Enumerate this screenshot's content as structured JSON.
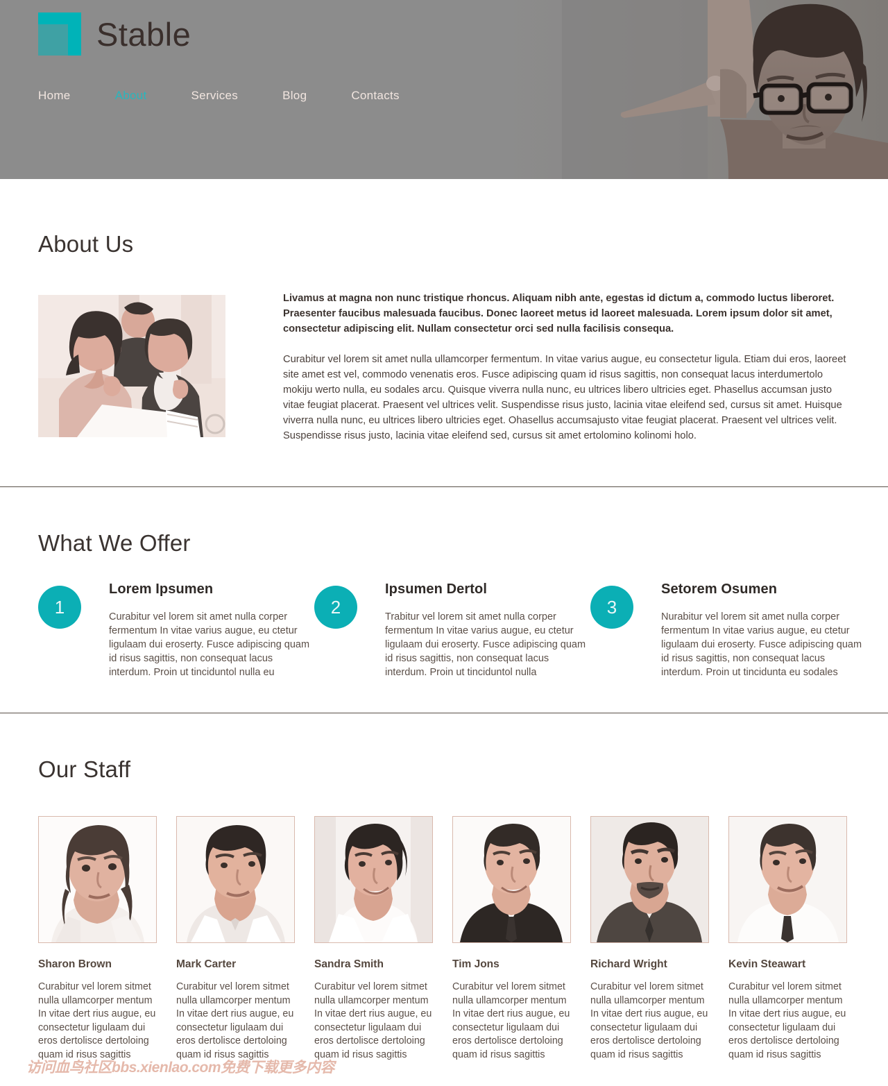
{
  "header": {
    "brand": "Stable",
    "logo_color": "#00b3b8",
    "nav": [
      {
        "label": "Home",
        "active": false
      },
      {
        "label": "About",
        "active": true
      },
      {
        "label": "Services",
        "active": false
      },
      {
        "label": "Blog",
        "active": false
      },
      {
        "label": "Contacts",
        "active": false
      }
    ],
    "hero_image_alt": "man-with-glasses-photo"
  },
  "about": {
    "title": "About Us",
    "image_alt": "two-women-reviewing-documents-photo",
    "paragraph_lead": "Livamus at magna non nunc tristique rhoncus. Aliquam nibh ante, egestas id dictum a, commodo luctus liberoret. Praesenter faucibus malesuada faucibus. Donec laoreet metus id laoreet malesuada. Lorem ipsum dolor sit amet, consectetur adipiscing elit. Nullam consectetur orci sed nulla facilisis consequa.",
    "paragraph_body": "Curabitur vel lorem sit amet nulla ullamcorper fermentum. In vitae varius augue, eu consectetur ligula. Etiam dui eros, laoreet site amet est vel, commodo venenatis eros. Fusce adipiscing quam id risus sagittis, non consequat lacus interdumertolo mokiju werto nulla, eu sodales arcu. Quisque viverra nulla nunc, eu ultrices libero ultricies eget. Phasellus accumsan justo vitae feugiat placerat. Praesent vel ultrices velit. Suspendisse risus justo, lacinia vitae eleifend sed, cursus sit amet. Huisque viverra nulla nunc, eu ultrices libero ultricies eget. Ohasellus accumsajusto vitae feugiat placerat. Praesent vel ultrices velit. Suspendisse risus justo, lacinia vitae eleifend sed, cursus sit amet ertolomino kolinomi holo."
  },
  "offer": {
    "title": "What We Offer",
    "accent_color": "#0bafb5",
    "items": [
      {
        "number": "1",
        "heading": "Lorem Ipsumen",
        "text": "Curabitur vel lorem sit amet nulla corper fermentum In vitae varius augue, eu ctetur ligulaam dui eroserty. Fusce adipiscing quam id risus sagittis, non consequat lacus interdum. Proin ut tinciduntol nulla eu"
      },
      {
        "number": "2",
        "heading": "Ipsumen Dertol",
        "text": "Trabitur vel lorem sit amet nulla corper fermentum In vitae varius augue, eu ctetur ligulaam dui eroserty. Fusce adipiscing quam id risus sagittis, non consequat lacus interdum. Proin ut tinciduntol nulla"
      },
      {
        "number": "3",
        "heading": "Setorem Osumen",
        "text": "Nurabitur vel lorem sit amet nulla corper fermentum In vitae varius augue, eu ctetur ligulaam dui eroserty. Fusce adipiscing quam id risus sagittis, non consequat lacus interdum. Proin ut tincidunta eu sodales"
      }
    ]
  },
  "staff": {
    "title": "Our Staff",
    "members": [
      {
        "name": "Sharon Brown",
        "bio": "Curabitur vel lorem sitmet nulla ullamcorper mentum In vitae dert rius augue, eu consectetur ligulaam dui eros dertolisce dertoloing quam id risus sagittis",
        "photo_alt": "portrait-sharon-brown"
      },
      {
        "name": "Mark Carter",
        "bio": "Curabitur vel lorem sitmet nulla ullamcorper mentum In vitae dert rius augue, eu consectetur ligulaam dui eros dertolisce dertoloing quam id risus sagittis",
        "photo_alt": "portrait-mark-carter"
      },
      {
        "name": "Sandra Smith",
        "bio": "Curabitur vel lorem sitmet nulla ullamcorper mentum In vitae dert rius augue, eu consectetur ligulaam dui eros dertolisce dertoloing quam id risus sagittis",
        "photo_alt": "portrait-sandra-smith"
      },
      {
        "name": "Tim Jons",
        "bio": "Curabitur vel lorem sitmet nulla ullamcorper mentum In vitae dert rius augue, eu consectetur ligulaam dui eros dertolisce dertoloing quam id risus sagittis",
        "photo_alt": "portrait-tim-jons"
      },
      {
        "name": "Richard Wright",
        "bio": "Curabitur vel lorem sitmet nulla ullamcorper mentum In vitae dert rius augue, eu consectetur ligulaam dui eros dertolisce dertoloing quam id risus sagittis",
        "photo_alt": "portrait-richard-wright"
      },
      {
        "name": "Kevin Steawart",
        "bio": "Curabitur vel lorem sitmet nulla ullamcorper mentum In vitae dert rius augue, eu consectetur ligulaam dui eros dertolisce dertoloing quam id risus sagittis",
        "photo_alt": "portrait-kevin-steawart"
      }
    ]
  },
  "watermark": {
    "text": "访问血鸟社区bbs.xienlao.com免费下载更多内容",
    "color": "#e5b9ab"
  }
}
